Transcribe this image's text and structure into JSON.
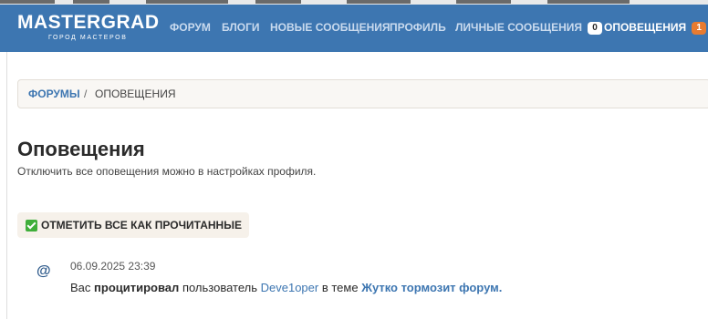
{
  "header": {
    "logo_title": "MASTERGRAD",
    "logo_subtitle": "ГОРОД МАСТЕРОВ",
    "nav": [
      {
        "label": "ФОРУМ"
      },
      {
        "label": "БЛОГИ"
      },
      {
        "label": "НОВЫЕ СООБЩЕНИЯ"
      },
      {
        "label": "ПРОФИЛЬ"
      },
      {
        "label": "ЛИЧНЫЕ СООБЩЕНИЯ",
        "badge": "0"
      },
      {
        "label": "ОПОВЕЩЕНИЯ",
        "badge": "1"
      }
    ]
  },
  "breadcrumb": {
    "link": "ФОРУМЫ",
    "separator": "/",
    "current": "ОПОВЕЩЕНИЯ"
  },
  "page": {
    "title": "Оповещения",
    "description": "Отключить все оповещения можно в настройках профиля.",
    "mark_all_label": "ОТМЕТИТЬ ВСЕ КАК ПРОЧИТАННЫЕ"
  },
  "notifications": [
    {
      "icon": "@",
      "time": "06.09.2025 23:39",
      "prefix": "Вас",
      "action": "процитировал",
      "middle": "пользователь",
      "user": "Deve1oper",
      "in_topic": "в теме",
      "topic": "Жутко тормозит форум."
    }
  ],
  "colors": {
    "header_bg": "#3d76b1",
    "link": "#3d76b1",
    "badge_orange": "#e87b30"
  }
}
